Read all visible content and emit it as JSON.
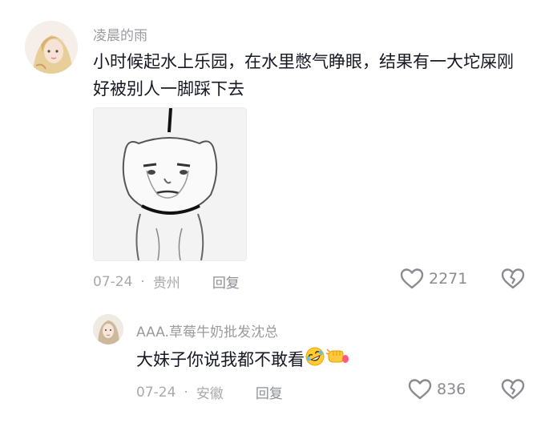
{
  "comments": [
    {
      "username": "凌晨的雨",
      "text": "小时候起水上乐园，在水里憋气睁眼，结果有一大坨屎刚好被别人一脚踩下去",
      "date": "07-24",
      "location": "贵州",
      "reply_label": "回复",
      "likes": "2271",
      "sticker_icon": "meme-sticker-icon"
    },
    {
      "username": "AAA.草莓牛奶批发沈总",
      "text": "大妹子你说我都不敢看",
      "date": "07-24",
      "location": "安徽",
      "reply_label": "回复",
      "likes": "836",
      "emoji_icons": [
        "rolling-on-floor-laughing-emoji",
        "fist-bump-emoji"
      ]
    }
  ],
  "separator": "·"
}
